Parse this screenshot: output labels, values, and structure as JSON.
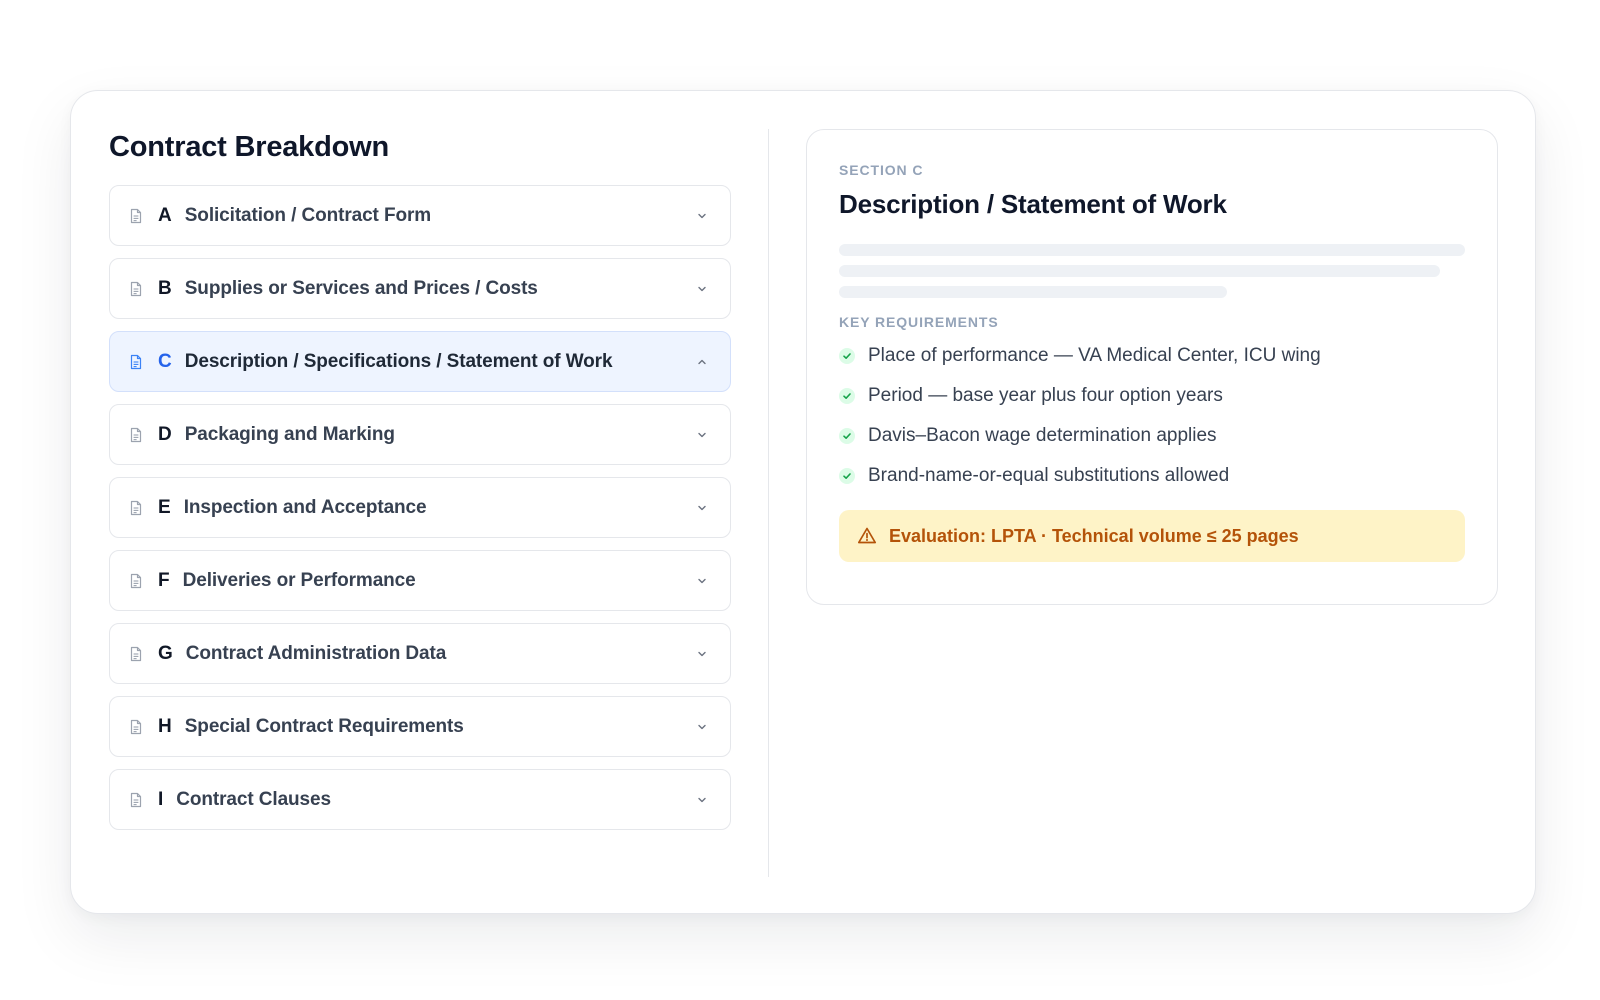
{
  "breakdown": {
    "title": "Contract Breakdown",
    "items": [
      {
        "letter": "A",
        "label": "Solicitation / Contract Form",
        "expanded": false
      },
      {
        "letter": "B",
        "label": "Supplies or Services and Prices / Costs",
        "expanded": false
      },
      {
        "letter": "C",
        "label": "Description / Specifications / Statement of Work",
        "expanded": true
      },
      {
        "letter": "D",
        "label": "Packaging and Marking",
        "expanded": false
      },
      {
        "letter": "E",
        "label": "Inspection and Acceptance",
        "expanded": false
      },
      {
        "letter": "F",
        "label": "Deliveries or Performance",
        "expanded": false
      },
      {
        "letter": "G",
        "label": "Contract Administration Data",
        "expanded": false
      },
      {
        "letter": "H",
        "label": "Special Contract Requirements",
        "expanded": false
      },
      {
        "letter": "I",
        "label": "Contract Clauses",
        "expanded": false
      }
    ]
  },
  "detail": {
    "eyebrow": "SECTION C",
    "title": "Description / Statement of Work",
    "requirements_heading": "KEY REQUIREMENTS",
    "requirements": [
      "Place of performance — VA Medical Center, ICU wing",
      "Period — base year plus four option years",
      "Davis–Bacon wage determination applies",
      "Brand-name-or-equal substitutions allowed"
    ],
    "callout": "Evaluation: LPTA · Technical volume ≤ 25 pages"
  },
  "icons": {
    "item": "document-icon",
    "collapsed": "chevron-down-icon",
    "expanded": "chevron-up-icon",
    "requirement": "check-icon",
    "callout": "warning-triangle-icon"
  },
  "colors": {
    "accent": "#2563eb",
    "active_bg": "#eef4ff",
    "check_green": "#16a34a",
    "warning_bg": "#fef3c7",
    "warning_text": "#b45309"
  }
}
